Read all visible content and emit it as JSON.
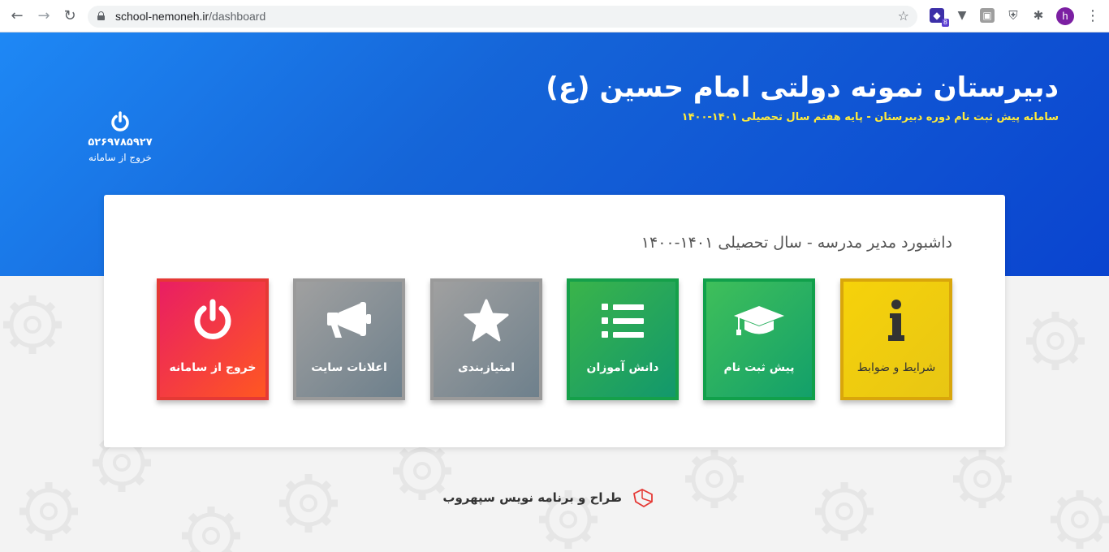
{
  "browser": {
    "url_host": "school-nemoneh.ir",
    "url_path": "/dashboard",
    "extension_badge": "8",
    "profile_initial": "h"
  },
  "header": {
    "title": "دبیرستان نمونه دولتی امام حسین (ع)",
    "subtitle": "سامانه پیش ثبت نام دوره دبیرستان - پایه هفتم سال تحصیلی ۱۴۰۱-۱۴۰۰",
    "user_id": "۵۲۶۹۷۸۵۹۲۷",
    "logout_label": "خروج از سامانه"
  },
  "dashboard": {
    "title": "داشبورد مدیر مدرسه - سال تحصیلی ۱۴۰۱-۱۴۰۰",
    "tiles": [
      {
        "label": "شرایط و ضوابط",
        "icon": "info-icon"
      },
      {
        "label": "پیش ثبت نام",
        "icon": "graduation-cap-icon"
      },
      {
        "label": "دانش آموزان",
        "icon": "list-icon"
      },
      {
        "label": "امتیازبندی",
        "icon": "star-icon"
      },
      {
        "label": "اعلانات سایت",
        "icon": "megaphone-icon"
      },
      {
        "label": "خروج از سامانه",
        "icon": "power-icon"
      }
    ]
  },
  "footer": {
    "credit": "طراح و برنامه نویس سپهروب"
  },
  "colors": {
    "hero_blue": "#1565d8",
    "subtitle_yellow": "#ffeb3b",
    "tile_rules": "#f6d20a",
    "tile_green": "#13a06a",
    "tile_gray": "#6e808c",
    "tile_red": "#e53935"
  }
}
